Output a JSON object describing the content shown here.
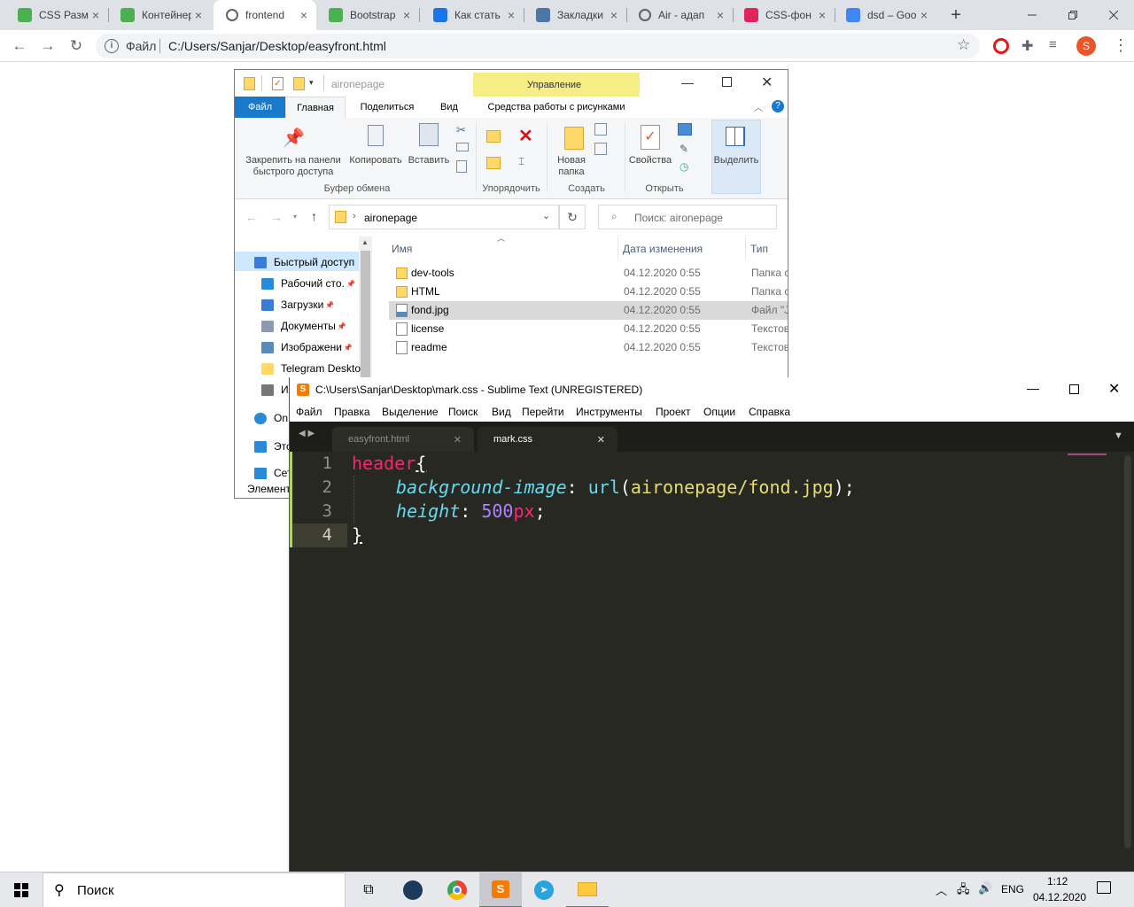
{
  "browser": {
    "tabs": [
      {
        "label": "CSS Размер",
        "favicon": "w3schools-icon",
        "color": "#4caf50"
      },
      {
        "label": "Контейнер",
        "favicon": "w3schools-icon",
        "color": "#4caf50"
      },
      {
        "label": "frontend",
        "favicon": "globe-icon",
        "color": "#5f6368",
        "active": true
      },
      {
        "label": "Bootstrap",
        "favicon": "w3schools-icon",
        "color": "#4caf50"
      },
      {
        "label": "Как стать",
        "favicon": "star-icon",
        "color": "#1a73e8"
      },
      {
        "label": "Закладки",
        "favicon": "vk-icon",
        "color": "#4a76a8"
      },
      {
        "label": "Air - адап",
        "favicon": "globe-icon",
        "color": "#5f6368"
      },
      {
        "label": "CSS-фон",
        "favicon": "htmlacademy-icon",
        "color": "#e0245e"
      },
      {
        "label": "dsd – Goo",
        "favicon": "google-icon",
        "color": "#4285f4"
      }
    ],
    "new_tab": "+",
    "address_scheme": "Файл",
    "address_url": "C:/Users/Sanjar/Desktop/easyfront.html",
    "profile_letter": "S"
  },
  "explorer": {
    "title": "aironepage",
    "manage_tab": "Управление",
    "ribbon_tabs": [
      "Файл",
      "Главная",
      "Поделиться",
      "Вид",
      "Средства работы с рисунками"
    ],
    "ribbon": {
      "pin": "Закрепить на панели быстрого доступа",
      "copy": "Копировать",
      "paste": "Вставить",
      "new_folder": "Новая папка",
      "properties": "Свойства",
      "select": "Выделить",
      "groups": [
        "Буфер обмена",
        "Упорядочить",
        "Создать",
        "Открыть"
      ]
    },
    "path_folder": "aironepage",
    "search_placeholder": "Поиск: aironepage",
    "columns": {
      "name": "Имя",
      "date": "Дата изменения",
      "type": "Тип"
    },
    "sidebar": [
      {
        "label": "Быстрый доступ",
        "icon": "star-icon"
      },
      {
        "label": "Рабочий сто.",
        "icon": "desktop-icon"
      },
      {
        "label": "Загрузки",
        "icon": "download-icon"
      },
      {
        "label": "Документы",
        "icon": "document-icon"
      },
      {
        "label": "Изображени",
        "icon": "picture-icon"
      },
      {
        "label": "Telegram Deskto",
        "icon": "folder-icon"
      },
      {
        "label": "И",
        "icon": "drive-icon"
      },
      {
        "label": "On",
        "icon": "cloud-icon"
      },
      {
        "label": "Это",
        "icon": "computer-icon"
      },
      {
        "label": "Сет",
        "icon": "network-icon"
      }
    ],
    "status": "Элемент",
    "files": [
      {
        "name": "dev-tools",
        "date": "04.12.2020 0:55",
        "type": "Папка с",
        "kind": "folder"
      },
      {
        "name": "HTML",
        "date": "04.12.2020 0:55",
        "type": "Папка с",
        "kind": "folder"
      },
      {
        "name": "fond.jpg",
        "date": "04.12.2020 0:55",
        "type": "Файл \"J",
        "kind": "image",
        "selected": true
      },
      {
        "name": "license",
        "date": "04.12.2020 0:55",
        "type": "Текстов",
        "kind": "text"
      },
      {
        "name": "readme",
        "date": "04.12.2020 0:55",
        "type": "Текстов",
        "kind": "text"
      }
    ]
  },
  "sublime": {
    "title": "C:\\Users\\Sanjar\\Desktop\\mark.css - Sublime Text (UNREGISTERED)",
    "menu": [
      "Файл",
      "Правка",
      "Выделение",
      "Поиск",
      "Вид",
      "Перейти",
      "Инструменты",
      "Проект",
      "Опции",
      "Справка"
    ],
    "tabs": [
      "easyfront.html",
      "mark.css"
    ],
    "line_numbers": [
      "1",
      "2",
      "3",
      "4"
    ],
    "code": {
      "l1_selector": "header",
      "l1_brace": "{",
      "l2_prop": "background-image",
      "l2_colon": ":",
      "l2_func": "url",
      "l2_open": "(",
      "l2_arg": "aironepage/fond.jpg",
      "l2_close": ")",
      "l2_semi": ";",
      "l3_prop": "height",
      "l3_colon": ":",
      "l3_num": "500",
      "l3_unit": "px",
      "l3_semi": ";",
      "l4_brace": "}"
    },
    "colors": {
      "bg": "#272822",
      "selector": "#f92672",
      "property": "#66d9ef",
      "string": "#e6db74",
      "number": "#ae81ff",
      "text": "#f8f8f2"
    }
  },
  "taskbar": {
    "search_label": "Поиск",
    "lang": "ENG",
    "time": "1:12",
    "date": "04.12.2020"
  }
}
